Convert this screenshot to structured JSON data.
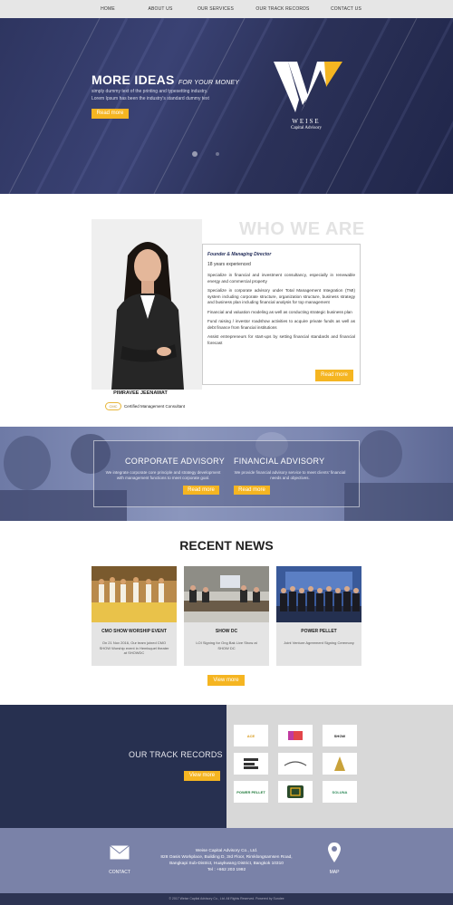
{
  "nav": {
    "items": [
      "HOME",
      "ABOUT US",
      "OUR SERVICES",
      "OUR TRACK RECORDS",
      "CONTACT US"
    ]
  },
  "hero": {
    "title": "MORE IDEAS",
    "title_suffix": "FOR YOUR MONEY",
    "desc_line1": "simply dummy text of the printing and typesetting industry.",
    "desc_line2": "Lorem Ipsum has been the industry's standard dummy text",
    "button": "Read more",
    "logo_name": "WEISE",
    "logo_sub": "Capital Advisory"
  },
  "who": {
    "title": "WHO WE ARE",
    "person_name": "PIMRAVEE JEENAWAT",
    "badge": "CMC",
    "badge_text": "Certified Management Consultant",
    "role": "Founder & Managing Director",
    "years": "18 years experienced",
    "points": [
      "Specialize in financial and investment consultancy, especially in renewable energy and commercial property",
      "Specialize in corporate advisory under Total Management Integration (TMI) system including corporate structure, organization structure, business strategy and business plan including financial analysis for top management",
      "Financial and valuation modeling as well as conducting strategic business plan",
      "Fund raising / investor roadshow activities to acquire private funds as well as debt finance from financial institutions",
      "Assist entrepreneurs for start-ups by setting financial standards and financial forecast"
    ],
    "button": "Read more"
  },
  "services": {
    "corporate_title": "CORPORATE ADVISORY",
    "corporate_desc": "We integrate corporate core principle and strategy development with management functions to meet corporate goal.",
    "financial_title": "FINANCIAL ADVISORY",
    "financial_desc": "We provide financial advisory service to meet clients' financial needs and objectives.",
    "button": "Read more"
  },
  "news": {
    "title": "RECENT NEWS",
    "cards": [
      {
        "title": "CMO SHOW WORSHIP EVENT",
        "desc": "On 21 Nov 2016, Our team joined CMO SHOW Worship event in Hemisquel theater at SHOWDC"
      },
      {
        "title": "SHOW DC",
        "desc": "LOI Signing for Ong Bak Live Show at SHOW DC"
      },
      {
        "title": "POWER PELLET",
        "desc": "Joint Venture Agreement Signing Ceremony"
      }
    ],
    "button": "View more"
  },
  "track": {
    "title": "OUR TRACK RECORDS",
    "button": "View more",
    "logos": [
      "ACE",
      "",
      "SHOW",
      "",
      "",
      "",
      "POWER PELLET",
      "",
      "SOLUNA"
    ]
  },
  "footer": {
    "company": "Weise Capital Advisory Co., Ltd.",
    "address1": "828 Oasis Workplace, Building D, 3rd Floor, Rimklongsamsen Road,",
    "address2": "Bangkapi Sub-District, Huaykwang District, Bangkok 10310",
    "tel": "Tel : +662 203 1992",
    "contact_label": "CONTACT",
    "map_label": "MAP",
    "copyright": "© 2017 Weise Capital Advisory Co., Ltd. All Rights Reserved. Powered by Sundee"
  },
  "colors": {
    "accent": "#f5b521",
    "navy": "#273050",
    "footer": "#7a82a8"
  }
}
